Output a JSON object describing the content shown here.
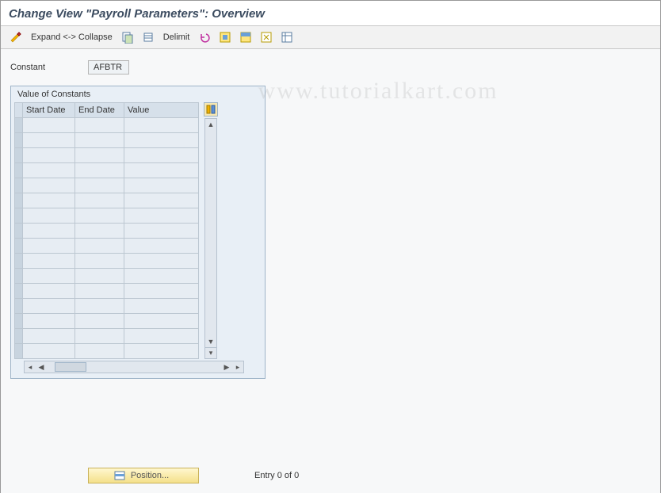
{
  "title": "Change View \"Payroll Parameters\": Overview",
  "toolbar": {
    "expand_collapse": "Expand <-> Collapse",
    "delimit": "Delimit"
  },
  "field": {
    "label": "Constant",
    "value": "AFBTR"
  },
  "panel": {
    "title": "Value of Constants",
    "columns": {
      "start": "Start Date",
      "end": "End Date",
      "value": "Value"
    },
    "row_count": 16
  },
  "footer": {
    "position_label": "Position...",
    "entry_text": "Entry 0 of 0"
  },
  "watermark": "www.tutorialkart.com"
}
